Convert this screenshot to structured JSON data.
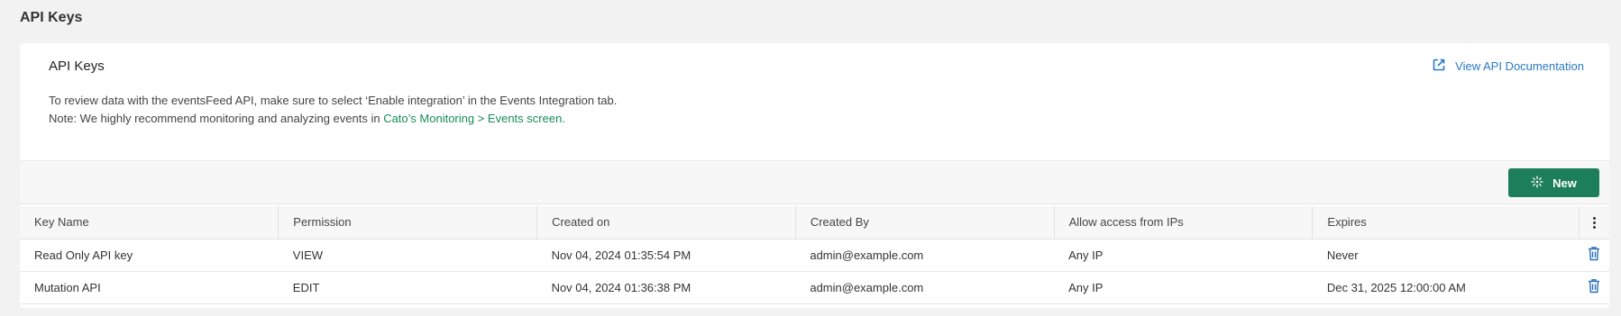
{
  "page": {
    "title": "API Keys"
  },
  "card": {
    "title": "API Keys",
    "doc_link_label": "View API Documentation",
    "desc_line1": "To review data with the eventsFeed API, make sure to select ‘Enable integration’ in the Events Integration tab.",
    "desc_line2_prefix": "Note: We highly recommend monitoring and analyzing events in ",
    "desc_line2_link": "Cato’s Monitoring > Events screen",
    "desc_line2_suffix": "."
  },
  "toolbar": {
    "new_label": "New"
  },
  "table": {
    "columns": [
      "Key Name",
      "Permission",
      "Created on",
      "Created By",
      "Allow access from IPs",
      "Expires"
    ],
    "rows": [
      [
        "Read Only API key",
        "VIEW",
        "Nov 04, 2024 01:35:54 PM",
        "admin@example.com",
        "Any IP",
        "Never"
      ],
      [
        "Mutation API",
        "EDIT",
        "Nov 04, 2024 01:36:38 PM",
        "admin@example.com",
        "Any IP",
        "Dec 31, 2025 12:00:00 AM"
      ]
    ]
  },
  "icons": {
    "doc_link": "external-link-icon",
    "new_button": "sparkle-icon",
    "column_menu": "kebab-menu-icon",
    "row_delete": "trash-icon"
  },
  "colors": {
    "primary_button": "#1c7e5a",
    "link_blue": "#2a7ac8",
    "link_green": "#1a8a5a",
    "delete_icon": "#2a6fb8"
  }
}
